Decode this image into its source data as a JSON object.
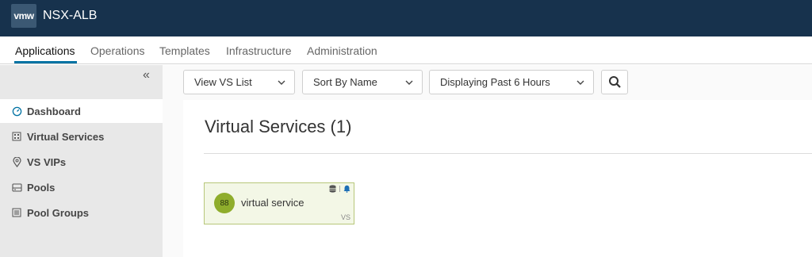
{
  "header": {
    "logo_text": "vmw",
    "title": "NSX-ALB"
  },
  "nav_tabs": [
    {
      "label": "Applications",
      "active": true
    },
    {
      "label": "Operations"
    },
    {
      "label": "Templates"
    },
    {
      "label": "Infrastructure"
    },
    {
      "label": "Administration"
    }
  ],
  "sidebar": {
    "collapse_icon": "double-chevron-left-icon",
    "items": [
      {
        "label": "Dashboard",
        "icon": "gauge-icon",
        "active": true
      },
      {
        "label": "Virtual Services",
        "icon": "grid-icon"
      },
      {
        "label": "VS VIPs",
        "icon": "location-pin-icon"
      },
      {
        "label": "Pools",
        "icon": "server-icon"
      },
      {
        "label": "Pool Groups",
        "icon": "list-icon"
      }
    ]
  },
  "toolbar": {
    "view_select": "View VS List",
    "sort_select": "Sort By Name",
    "time_select": "Displaying Past 6 Hours",
    "search_icon": "search-icon"
  },
  "page": {
    "heading": "Virtual Services (1)"
  },
  "vs_card": {
    "health_score": "88",
    "name": "virtual service",
    "type_tag": "VS",
    "health_color": "#8fad2c",
    "icons": [
      "database-icon",
      "bell-icon"
    ]
  },
  "colors": {
    "topbar": "#17324d",
    "accent": "#0072a3"
  }
}
